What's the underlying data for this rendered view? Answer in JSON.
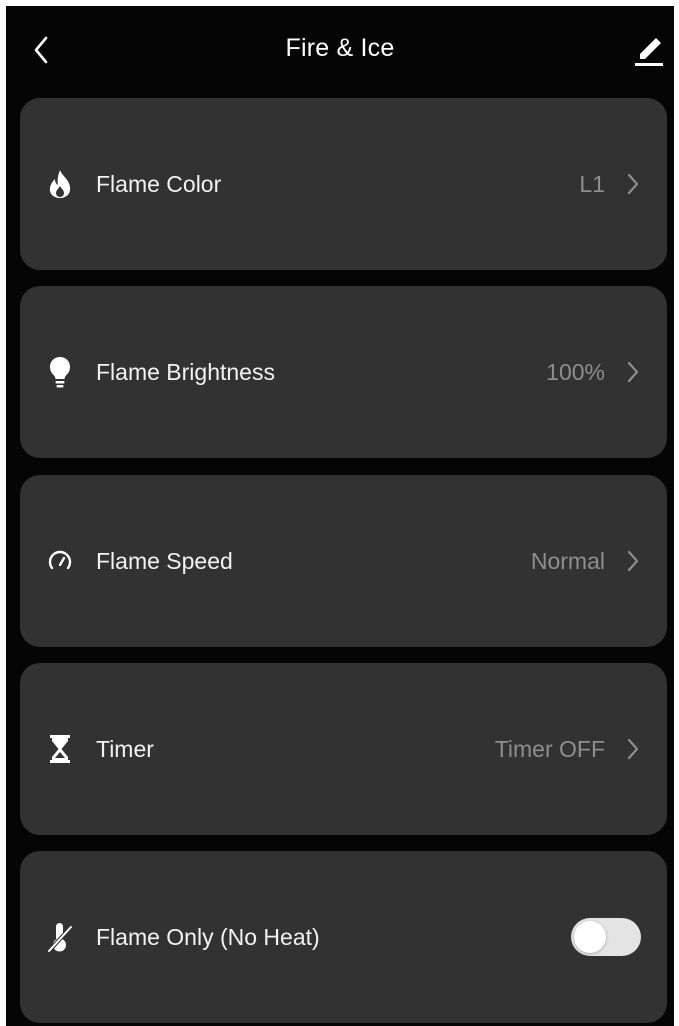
{
  "header": {
    "title": "Fire & Ice",
    "back_icon": "chevron-left-icon",
    "edit_icon": "pencil-icon"
  },
  "settings": [
    {
      "id": "flame-color",
      "icon": "flame-icon",
      "label": "Flame Color",
      "value": "L1"
    },
    {
      "id": "flame-brightness",
      "icon": "lightbulb-icon",
      "label": "Flame Brightness",
      "value": "100%"
    },
    {
      "id": "flame-speed",
      "icon": "speedometer-icon",
      "label": "Flame Speed",
      "value": "Normal"
    },
    {
      "id": "timer",
      "icon": "hourglass-icon",
      "label": "Timer",
      "value": "Timer OFF"
    },
    {
      "id": "flame-only",
      "icon": "thermometer-off-icon",
      "label": "Flame Only (No Heat)",
      "toggle_on": false
    }
  ],
  "colors": {
    "background": "#050505",
    "card": "#323232",
    "text": "#f2f2f2",
    "secondary_text": "#8e8e8e",
    "toggle_off_track": "#e4e4e4"
  }
}
